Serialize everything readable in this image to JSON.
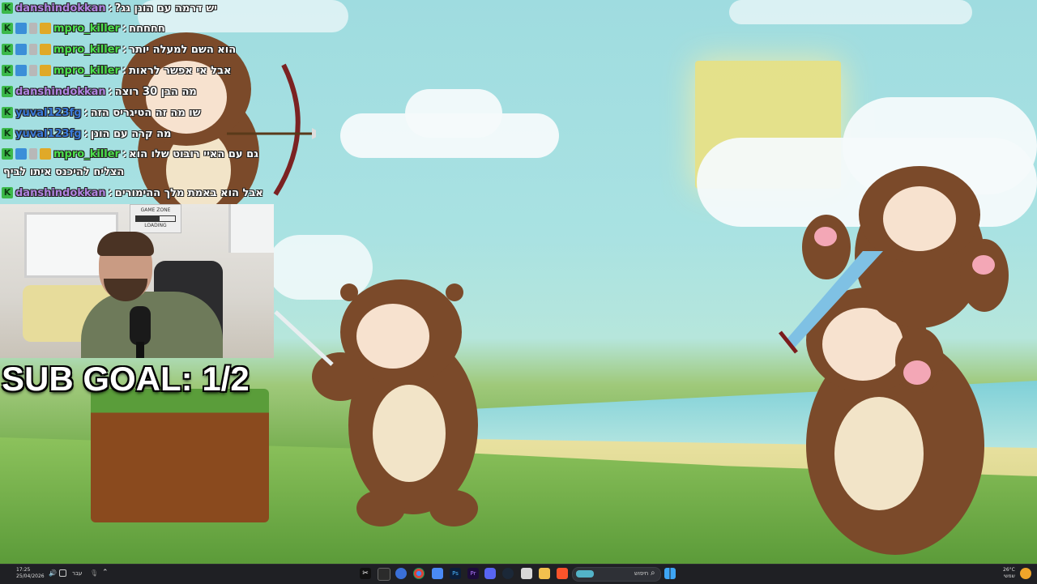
{
  "chat": {
    "messages": [
      {
        "user": "danshindokkan",
        "sep": ":",
        "text": "יש דרמה עם הונן גג?",
        "badges": [
          "k"
        ]
      },
      {
        "user": "mpro_killer",
        "sep": ":",
        "text": "חחחחח",
        "badges": [
          "k",
          "blue",
          "gray",
          "gold"
        ]
      },
      {
        "user": "mpro_killer",
        "sep": ":",
        "text": "הוא השם למעלה יותר",
        "badges": [
          "k",
          "blue",
          "gray",
          "gold"
        ]
      },
      {
        "user": "mpro_killer",
        "sep": ":",
        "text": "אבל אי אפשר לראות",
        "badges": [
          "k",
          "blue",
          "gray",
          "gold"
        ]
      },
      {
        "user": "danshindokkan",
        "sep": ":",
        "text": "מה הבן 30 רוצה",
        "badges": [
          "k"
        ]
      },
      {
        "user": "yuval123fg",
        "sep": ":",
        "text": "שו מה זה הטיגריס הזה",
        "badges": [
          "k"
        ]
      },
      {
        "user": "yuval123fg",
        "sep": ":",
        "text": "מה קרה עם הונן",
        "badges": [
          "k"
        ]
      },
      {
        "user": "mpro_killer",
        "sep": ":",
        "text": "גם עם האיי רובוט שלו הוא",
        "badges": [
          "k",
          "blue",
          "gray",
          "gold"
        ]
      },
      {
        "user": "danshindokkan",
        "sep": ":",
        "text": "אבל הוא באמת מלך ההימורים",
        "badges": [
          "k"
        ]
      }
    ],
    "wrap_line": "הצליח להיכנס איתו לביף"
  },
  "webcam": {
    "poster_title": "GAME ZONE",
    "poster_sub": "LOADING"
  },
  "overlay": {
    "sub_goal": "SUB GOAL: 1/2"
  },
  "taskbar": {
    "time": "17:25",
    "date": "25/04/2026",
    "language": "עבר",
    "search_placeholder": "חיפוש",
    "weather_temp": "26°C",
    "weather_text": "שמשי"
  },
  "colors": {
    "user_purple": "#b083e0",
    "user_green": "#4ce04c",
    "user_blue": "#3a7ad8",
    "taskbar_bg": "#1f2024"
  }
}
